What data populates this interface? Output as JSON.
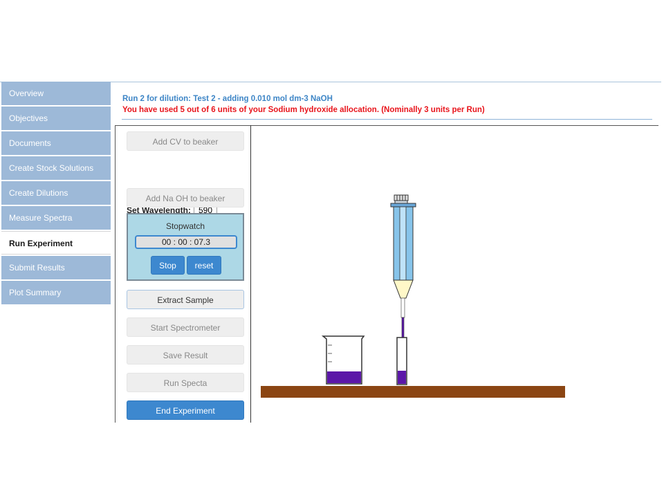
{
  "sidebar": {
    "items": [
      {
        "label": "Overview",
        "active": false
      },
      {
        "label": "Objectives",
        "active": false
      },
      {
        "label": "Documents",
        "active": false
      },
      {
        "label": "Create Stock Solutions",
        "active": false
      },
      {
        "label": "Create Dilutions",
        "active": false
      },
      {
        "label": "Measure Spectra",
        "active": false
      },
      {
        "label": "Run Experiment",
        "active": true
      },
      {
        "label": "Submit Results",
        "active": false
      },
      {
        "label": "Plot Summary",
        "active": false
      }
    ]
  },
  "header": {
    "title": "Run 2 for dilution: Test 2 - adding 0.010 mol dm-3 NaOH",
    "warning": "You have used 5 out of 6 units of your Sodium hydroxide allocation. (Nominally 3 units per Run)"
  },
  "controls": {
    "add_cv": "Add CV to beaker",
    "wavelength_label": "Set Wavelength:",
    "wavelength_value": "590",
    "add_naoh": "Add Na OH to beaker",
    "extract_sample": "Extract Sample",
    "start_spectrometer": "Start Spectrometer",
    "save_result": "Save Result",
    "run_spectra": "Run Specta",
    "end_experiment": "End Experiment"
  },
  "stopwatch": {
    "title": "Stopwatch",
    "time": "00 : 00 : 07.3",
    "stop_label": "Stop",
    "reset_label": "reset"
  },
  "colors": {
    "solution": "#5b17a8",
    "bench": "#8b4513",
    "syringe_body": "#87c4ea",
    "syringe_tip": "#fff8c8",
    "nav_bg": "#9db9d8",
    "primary_button": "#3d88cf",
    "warning_text": "#e8141b",
    "title_text": "#3d85c6"
  }
}
